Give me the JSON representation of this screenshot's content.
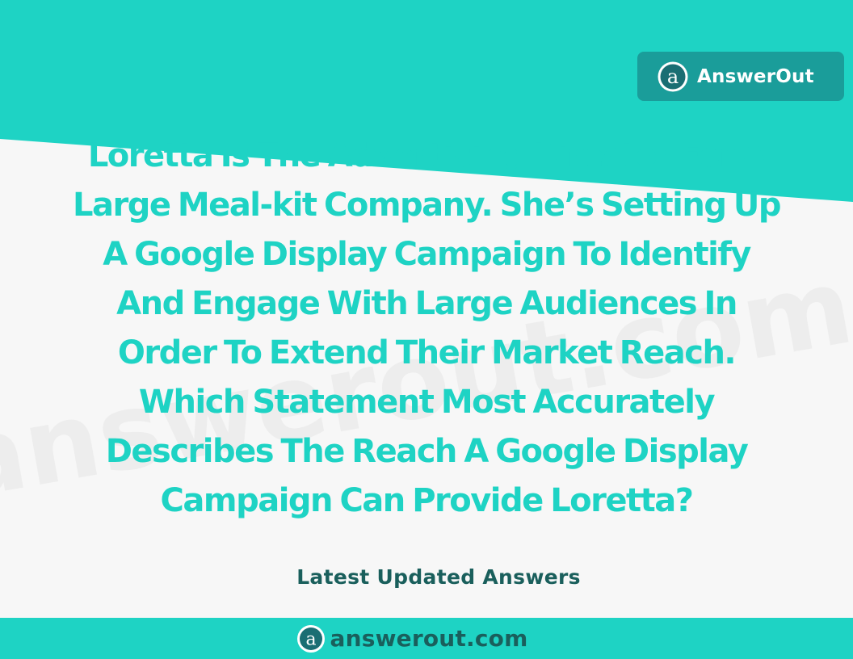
{
  "colors": {
    "background": "#f7f7f7",
    "teal": "#1ed3c4",
    "teal_text": "#1ed3c4",
    "badge_bg": "#1a9d9a",
    "dark_text": "#1a5f5c",
    "watermark": "#ebebeb"
  },
  "brand": {
    "logo_icon": "at-sign-icon",
    "name": "AnswerOut"
  },
  "question": {
    "lines": [
      "Loretta Is The Advertising Director For A",
      "Large Meal-kit Company. She’s Setting Up",
      "A Google Display Campaign To Identify",
      "And Engage With Large Audiences In",
      "Order To Extend Their Market Reach.",
      "Which Statement Most Accurately",
      "Describes The Reach A Google Display",
      "Campaign Can Provide Loretta?"
    ]
  },
  "watermark_text": "answerout.com",
  "latest_label": "Latest Updated Answers",
  "footer": {
    "logo_icon": "at-sign-icon",
    "domain": "answerout.com"
  }
}
